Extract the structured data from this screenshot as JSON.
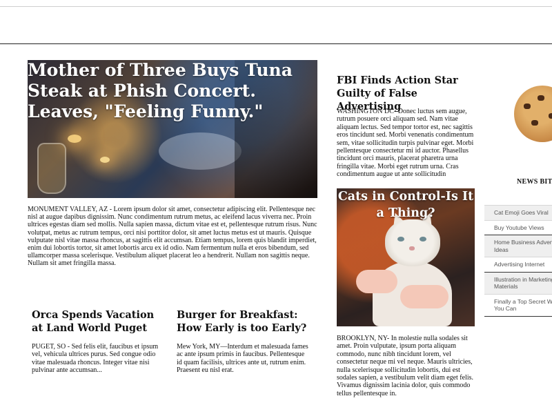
{
  "lead_story": {
    "headline": "Mother of Three Buys Tuna Steak at Phish Concert. Leaves, \"Feeling Funny.\"",
    "body": "MONUMENT VALLEY, AZ - Lorem ipsum dolor sit amet, consectetur adipiscing elit. Pellentesque nec nisl at augue dapibus dignissim. Nunc condimentum rutrum metus, ac eleifend lacus viverra nec. Proin ultrices egestas diam sed mollis. Nulla sapien massa, dictum vitae est et, pellentesque rutrum risus. Nunc volutpat, metus ac rutrum tempus, orci nisi porttitor dolor, sit amet luctus metus est ut mauris. Quisque vulputate nisl vitae massa rhoncus, at sagittis elit accumsan. Etiam tempus, lorem quis blandit imperdiet, enim dui lobortis tortor, sit amet lobortis arcu ex id odio. Nam fermentum nulla et eros bibendum, sed ullamcorper massa scelerisque. Vestibulum aliquet placerat leo a hendrerit. Nullam non sagittis neque. Nullam sit amet fringilla massa."
  },
  "fbi_story": {
    "headline": "FBI Finds Action Star Guilty of False Advertising",
    "body": "WASHINGTON DC- Donec luctus sem augue, rutrum posuere orci aliquam sed. Nam vitae aliquam lectus. Sed tempor tortor est, nec sagittis eros tincidunt sed. Morbi venenatis condimentum sem, vitae sollicitudin turpis pulvinar eget. Morbi pellentesque consectetur mi id auctor. Phasellus tincidunt orci mauris, placerat pharetra urna fringilla vitae. Morbi eget rutrum urna. Cras condimentum augue ut ante sollicitudin"
  },
  "cat_story": {
    "headline": "Cats in Control-Is It a Thing?",
    "body": "BROOKLYN, NY- In molestie nulla sodales sit amet. Proin vulputate, ipsum porta aliquam commodo, nunc nibh tincidunt lorem, vel consectetur neque mi vel neque. Mauris ultricies, nulla scelerisque sollicitudin lobortis, dui est sodales sapien, a vestibulum velit diam eget felis. Vivamus dignissim lacinia dolor, quis commodo tellus pellentesque in."
  },
  "orca_story": {
    "headline": "Orca Spends Vacation at Land World Puget",
    "body": "PUGET, SO - Sed felis elit, faucibus et ipsum vel, vehicula ultrices purus. Sed congue odio vitae malesuada rhoncus. Integer vitae nisi pulvinar ante accumsan..."
  },
  "burger_story": {
    "headline": "Burger for Breakfast: How Early is too Early?",
    "body": "Mew York, MY—Interdum et malesuada fames ac ante ipsum primis in faucibus. Pellentesque id quam facilisis, ultrices ante ut, rutrum enim. Praesent eu nisl erat."
  },
  "sidebar": {
    "news_bits_heading": "NEWS BITS",
    "items": [
      "Cat Emoji Goes Viral",
      "Buy Youtube Views",
      "Home Business Adventure Ideas",
      "Advertising Internet",
      "Illustration in Marketing Materials",
      "Finally a Top Secret Way You Can"
    ]
  }
}
